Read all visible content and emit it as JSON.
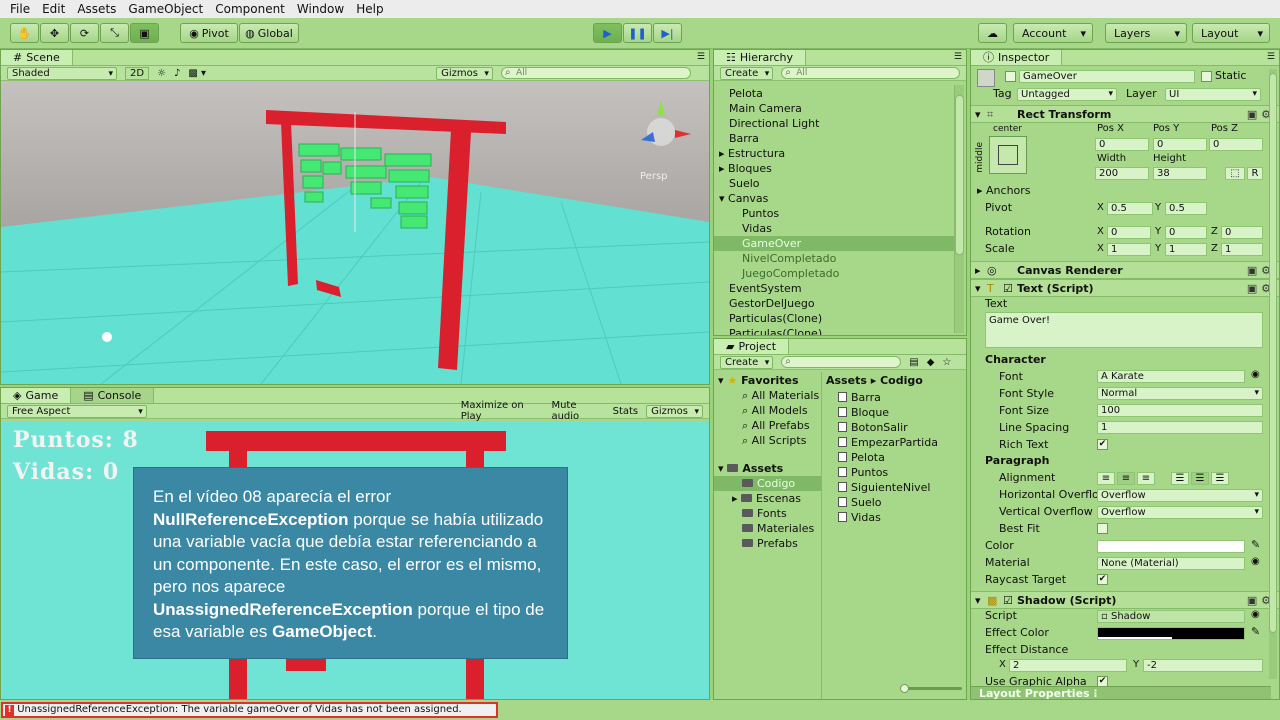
{
  "menu": [
    "File",
    "Edit",
    "Assets",
    "GameObject",
    "Component",
    "Window",
    "Help"
  ],
  "toolbar": {
    "pivot": "Pivot",
    "global": "Global",
    "account": "Account",
    "layers": "Layers",
    "layout": "Layout"
  },
  "scene": {
    "tab": "Scene",
    "shading": "Shaded",
    "mode2d": "2D",
    "gizmos": "Gizmos",
    "search": "All",
    "persp": "Persp"
  },
  "game": {
    "tab": "Game",
    "console_tab": "Console",
    "aspect": "Free Aspect",
    "maximize": "Maximize on Play",
    "mute": "Mute audio",
    "stats": "Stats",
    "gizmos": "Gizmos",
    "puntos": "Puntos: 8",
    "vidas": "Vidas: 0"
  },
  "overlay": {
    "t1": "En el vídeo 08 aparecía el error ",
    "b1": "NullReferenceException",
    "t2": " porque se había utilizado una variable vacía que debía estar referenciando a un componente. En este caso, el error es el mismo, pero nos aparece ",
    "b2": "UnassignedReferenceException",
    "t3": " porque el tipo de esa variable es ",
    "b3": "GameObject",
    "t4": "."
  },
  "hierarchy": {
    "tab": "Hierarchy",
    "create": "Create",
    "search": "All",
    "items": [
      "Pelota",
      "Main Camera",
      "Directional Light",
      "Barra",
      "Estructura",
      "Bloques",
      "Suelo",
      "Canvas",
      "Puntos",
      "Vidas",
      "GameOver",
      "NivelCompletado",
      "JuegoCompletado",
      "EventSystem",
      "GestorDelJuego",
      "Particulas(Clone)",
      "Particulas(Clone)"
    ]
  },
  "project": {
    "tab": "Project",
    "create": "Create",
    "favorites": "Favorites",
    "fav_items": [
      "All Materials",
      "All Models",
      "All Prefabs",
      "All Scripts"
    ],
    "assets": "Assets",
    "asset_folders": [
      "Codigo",
      "Escenas",
      "Fonts",
      "Materiales",
      "Prefabs"
    ],
    "breadcrumb_root": "Assets",
    "breadcrumb_leaf": "Codigo",
    "files": [
      "Barra",
      "Bloque",
      "BotonSalir",
      "EmpezarPartida",
      "Pelota",
      "Puntos",
      "SiguienteNivel",
      "Suelo",
      "Vidas"
    ]
  },
  "inspector": {
    "tab": "Inspector",
    "name": "GameOver",
    "static": "Static",
    "tag_label": "Tag",
    "tag": "Untagged",
    "layer_label": "Layer",
    "layer": "UI",
    "rect": {
      "title": "Rect Transform",
      "center": "center",
      "middle": "middle",
      "posx_l": "Pos X",
      "posy_l": "Pos Y",
      "posz_l": "Pos Z",
      "posx": "0",
      "posy": "0",
      "posz": "0",
      "width_l": "Width",
      "height_l": "Height",
      "width": "200",
      "height": "38",
      "r": "R",
      "anchors": "Anchors",
      "pivot": "Pivot",
      "pivot_x": "0.5",
      "pivot_y": "0.5",
      "rotation": "Rotation",
      "rot": [
        "0",
        "0",
        "0"
      ],
      "scale": "Scale",
      "sc": [
        "1",
        "1",
        "1"
      ]
    },
    "canvas_renderer": "Canvas Renderer",
    "text": {
      "title": "Text (Script)",
      "text_label": "Text",
      "value": "Game Over!",
      "character": "Character",
      "font_l": "Font",
      "font": "Karate",
      "style_l": "Font Style",
      "style": "Normal",
      "size_l": "Font Size",
      "size": "100",
      "spacing_l": "Line Spacing",
      "spacing": "1",
      "rich_l": "Rich Text",
      "paragraph": "Paragraph",
      "align_l": "Alignment",
      "hover_l": "Horizontal Overflo",
      "hover": "Overflow",
      "vover_l": "Vertical Overflow",
      "vover": "Overflow",
      "best_l": "Best Fit",
      "color_l": "Color",
      "material_l": "Material",
      "material": "None (Material)",
      "raycast_l": "Raycast Target"
    },
    "shadow": {
      "title": "Shadow (Script)",
      "script_l": "Script",
      "script": "Shadow",
      "ecolor_l": "Effect Color",
      "edist_l": "Effect Distance",
      "x": "2",
      "y": "-2",
      "graphic_l": "Use Graphic Alpha"
    },
    "layout_props": "Layout Properties"
  },
  "status": {
    "error": "UnassignedReferenceException: The variable gameOver of Vidas has not been assigned."
  },
  "axes": {
    "x": "X",
    "y": "Y",
    "z": "Z"
  }
}
